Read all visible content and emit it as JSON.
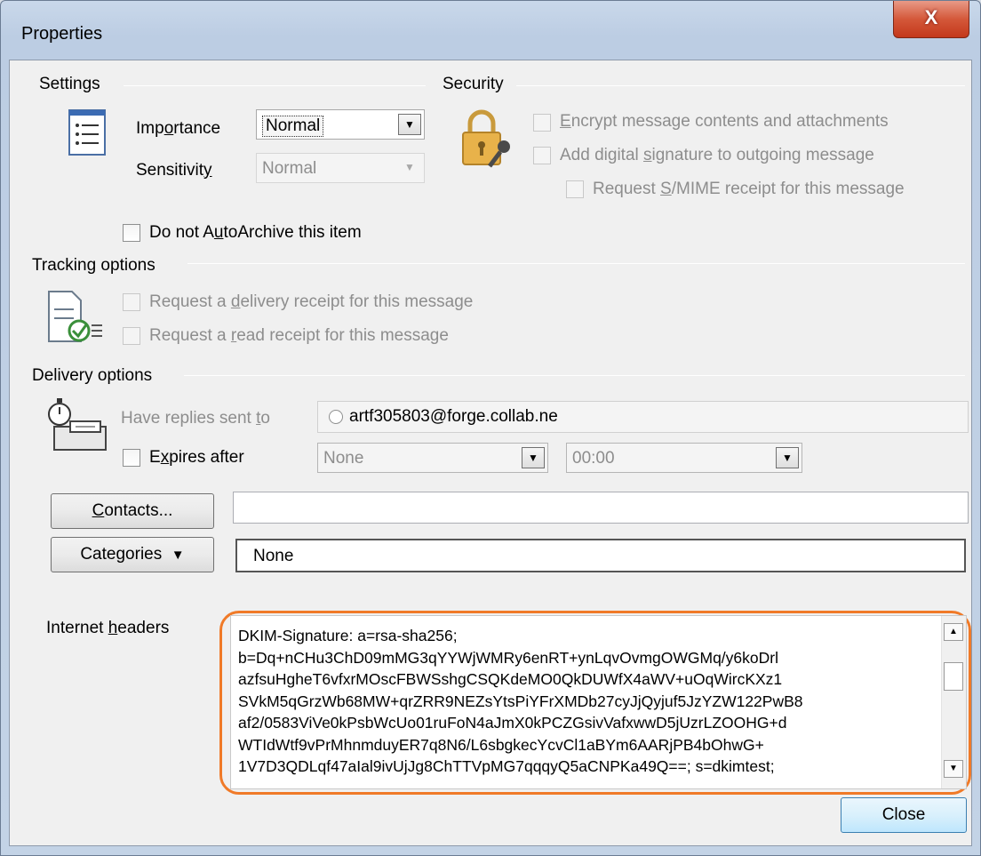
{
  "window": {
    "title": "Properties",
    "close_glyph": "X"
  },
  "settings": {
    "label": "Settings",
    "importance": {
      "pre": "Imp",
      "key": "o",
      "post": "rtance",
      "value": "Normal"
    },
    "sensitivity": {
      "pre": "Sensitivit",
      "key": "y",
      "post": "",
      "value": "Normal"
    },
    "autoarchive": {
      "pre": "Do not A",
      "key": "u",
      "post": "toArchive this item"
    }
  },
  "security": {
    "label": "Security",
    "encrypt": {
      "pre": "",
      "key": "E",
      "post": "ncrypt message contents and attachments"
    },
    "signature": {
      "pre": "Add digital ",
      "key": "s",
      "post": "ignature to outgoing message"
    },
    "smime": {
      "pre": "Request ",
      "key": "S",
      "post": "/MIME receipt for this message"
    }
  },
  "tracking": {
    "label": "Tracking options",
    "delivery": {
      "pre": "Request a ",
      "key": "d",
      "post": "elivery receipt for this message"
    },
    "read": {
      "pre": "Request a ",
      "key": "r",
      "post": "ead receipt for this message"
    }
  },
  "delivery": {
    "label": "Delivery options",
    "replies": {
      "pre": "Have replies sent ",
      "key": "t",
      "post": "o",
      "value": "artf305803@forge.collab.ne"
    },
    "expires": {
      "pre": "E",
      "key": "x",
      "post": "pires after",
      "date": "None",
      "time": "00:00"
    }
  },
  "contacts": {
    "key": "C",
    "post": "ontacts...",
    "value": ""
  },
  "categories": {
    "pre": "Cate",
    "key": "g",
    "post": "ories",
    "arrow": "▼",
    "value": "None"
  },
  "headers": {
    "label_pre": "Internet ",
    "label_key": "h",
    "label_post": "eaders",
    "lines": [
      "DKIM-Signature: a=rsa-sha256;",
      "b=Dq+nCHu3ChD09mMG3qYYWjWMRy6enRT+ynLqvOvmgOWGMq/y6koDrl",
      "azfsuHgheT6vfxrMOscFBWSshgCSQKdeMO0QkDUWfX4aWV+uOqWircKXz1",
      "SVkM5qGrzWb68MW+qrZRR9NEZsYtsPiYFrXMDb27cyJjQyjuf5JzYZW122PwB8",
      "af2/0583ViVe0kPsbWcUo01ruFoN4aJmX0kPCZGsivVafxwwD5jUzrLZOOHG+d",
      "WTIdWtf9vPrMhnmduyER7q8N6/L6sbgkecYcvCl1aBYm6AARjPB4bOhwG+",
      "1V7D3QDLqf47aIal9ivUjJg8ChTTVpMG7qqqyQ5aCNPKa49Q==; s=dkimtest;"
    ],
    "highlight_color": "#f07a28"
  },
  "close_button": "Close"
}
